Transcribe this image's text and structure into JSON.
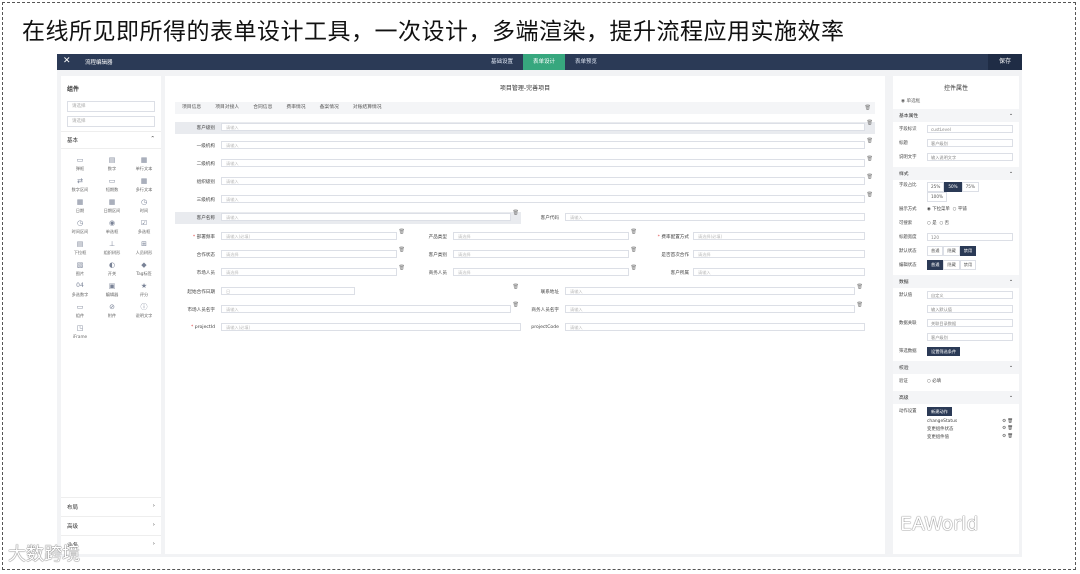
{
  "slide_title": "在线所见即所得的表单设计工具，一次设计，多端渲染，提升流程应用实施效率",
  "app": {
    "name": "流程编辑器",
    "tabs": [
      "基础设置",
      "表单设计",
      "表单预览"
    ],
    "save": "保存",
    "accent": "#37a77e",
    "nav_color": "#2b3a56"
  },
  "left_panel": {
    "title": "组件",
    "search1": "请选择",
    "search2": "请选择",
    "basic_label": "基本",
    "components": [
      "弹框",
      "数字",
      "单行文本",
      "数字区间",
      "短期数",
      "多行文本",
      "日期",
      "日期区间",
      "时间",
      "时间区间",
      "单选框",
      "多选框",
      "下拉框",
      "组织树形",
      "人员树形",
      "图片",
      "开关",
      "Tag标签",
      "多选数字",
      "编辑器",
      "评分",
      "组件",
      "附件",
      "说明文字",
      "iFrame"
    ],
    "sections": [
      "布局",
      "高级",
      "业务"
    ]
  },
  "form": {
    "title": "项目管理-完善项目",
    "tabs": [
      "项目信息",
      "项目对接人",
      "合同信息",
      "费率情况",
      "备案情况",
      "对账结算情况"
    ],
    "placeholder_input": "请输入",
    "placeholder_select": "请选择",
    "labels": {
      "customer_level": "客户级别",
      "org1": "一级机构",
      "org2": "二级机构",
      "org_rank": "组织级别",
      "org3": "三级机构",
      "customer_name": "客户名称",
      "customer_code": "客户代码",
      "deploy_rate": "部署频率",
      "product_type": "产品类型",
      "fee_config": "费率配置方式",
      "coop_status": "合作状态",
      "customer_type": "客户类别",
      "first_file": "是否首次合作",
      "market_staff": "市场人员",
      "business_staff": "商务人员",
      "customer_group": "客户所属",
      "start_date": "起始合作日期",
      "contact": "联系地址",
      "market_name": "市场人员名字",
      "business_name": "商务人员名字",
      "project_id": "projectId",
      "project_code": "projectCode"
    },
    "placeholder_required": "请输入(必填)",
    "placeholder_select_required": "请选择(必填)",
    "date_hint": "日"
  },
  "right_panel": {
    "title": "控件属性",
    "radio_single": "单选框",
    "sec_basic": "基本属性",
    "field_id_label": "字段标识",
    "field_id_value": "custLevel",
    "title_label": "标题",
    "title_value": "客户级别",
    "desc_label": "说明文字",
    "desc_placeholder": "输入说明文字",
    "sec_style": "样式",
    "width_label": "字段占比",
    "width_options": [
      "25%",
      "50%",
      "75%",
      "100%"
    ],
    "display_label": "展示方式",
    "display_options": [
      "下拉菜单",
      "平铺"
    ],
    "search_label": "可搜索",
    "search_options": [
      "是",
      "否"
    ],
    "label_width_label": "标题宽度",
    "label_width_value": "120",
    "default_state_label": "默认状态",
    "state_options": [
      "普通",
      "隐藏",
      "禁用"
    ],
    "edit_state_label": "编辑状态",
    "edit_options": [
      "普通",
      "隐藏",
      "禁用"
    ],
    "sec_data": "数据",
    "default_value_label": "默认值",
    "default_value_select": "自定义",
    "default_value_input": "输入默认值",
    "data_link_label": "数据关联",
    "data_link_select": "关联目录数据",
    "data_link_value": "客户级别",
    "filter_label": "筛选数据",
    "filter_button": "设置筛选条件",
    "sec_validate": "校验",
    "validate_label": "验证",
    "validate_required": "必填",
    "sec_advanced": "高级",
    "action_label": "动作设置",
    "action_button": "新建动作",
    "actions": [
      "changeStatus",
      "变更组件状态",
      "变更组件值"
    ]
  },
  "watermarks": {
    "left": "大数跨境",
    "right": "EAWorld"
  }
}
